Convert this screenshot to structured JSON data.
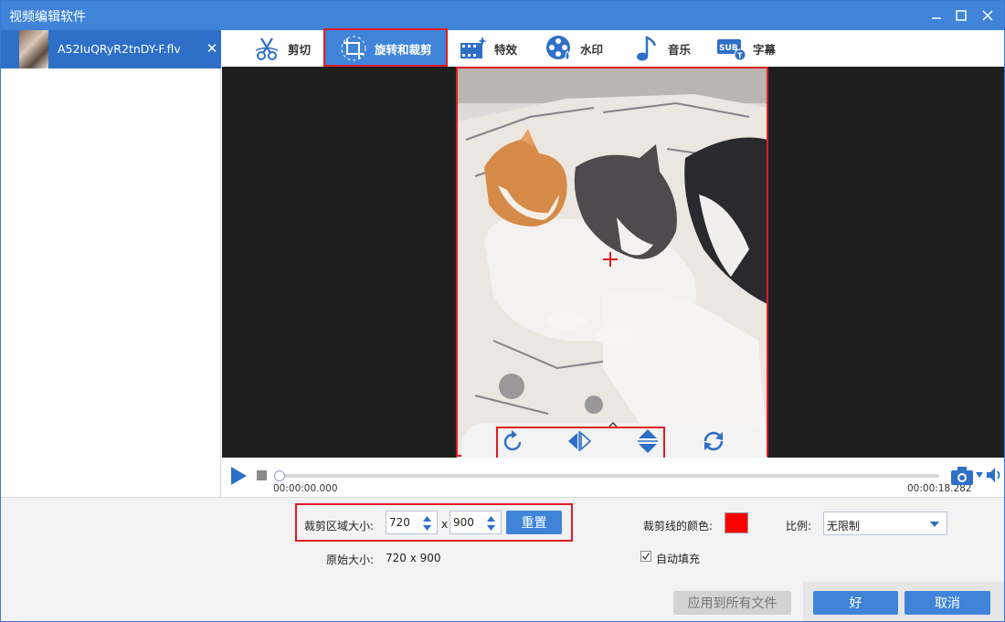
{
  "window": {
    "title": "视频编辑软件",
    "controls": {
      "minimize": "—",
      "maximize": "☐",
      "close": "✕"
    }
  },
  "file_list": {
    "items": [
      {
        "name": "A52IuQRyR2tnDY-F.flv",
        "close": "✕",
        "selected": true
      }
    ]
  },
  "toolbar": {
    "tabs": [
      {
        "label": "剪切",
        "icon": "scissors-icon",
        "active": false
      },
      {
        "label": "旋转和裁剪",
        "icon": "crop-rotate-icon",
        "active": true
      },
      {
        "label": "特效",
        "icon": "film-effects-icon",
        "active": false
      },
      {
        "label": "水印",
        "icon": "watermark-reel-icon",
        "active": false
      },
      {
        "label": "音乐",
        "icon": "music-note-icon",
        "active": false
      },
      {
        "label": "字幕",
        "icon": "subtitle-icon",
        "active": false
      }
    ]
  },
  "preview": {
    "controls": [
      "rotate-clockwise-icon",
      "flip-horizontal-icon",
      "flip-vertical-icon",
      "reset-rotation-icon"
    ]
  },
  "player": {
    "current_time": "00:00:00.000",
    "total_time": "00:00:18.282",
    "progress": 0
  },
  "settings": {
    "crop_size_label": "裁剪区域大小:",
    "crop_width": "720",
    "crop_height": "900",
    "size_separator": "x",
    "reset_label": "重置",
    "original_size_label": "原始大小:",
    "original_size_value": "720 x 900",
    "crop_line_color_label": "裁剪线的颜色:",
    "crop_line_color": "#ff0000",
    "ratio_label": "比例:",
    "ratio_value": "无限制",
    "auto_fill_label": "自动填充",
    "auto_fill_checked": true,
    "apply_all_label": "应用到所有文件",
    "ok_label": "好",
    "cancel_label": "取消"
  },
  "colors": {
    "accent": "#3f84d8",
    "highlight_outline": "#e01b24"
  }
}
